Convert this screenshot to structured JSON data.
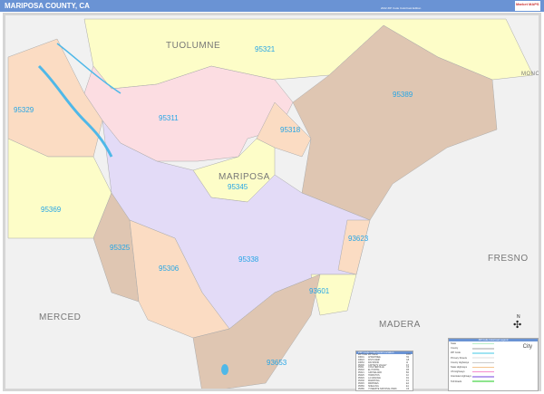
{
  "header": {
    "title": "MARIPOSA COUNTY, CA",
    "edition": "2022 ZIP Code ColorCast Edition",
    "logo": "Market MAPS"
  },
  "map": {
    "counties": [
      "TUOLUMNE",
      "MARIPOSA",
      "MERCED",
      "MADERA",
      "FRESNO",
      "MONO"
    ],
    "zips": [
      "95321",
      "95389",
      "95311",
      "95318",
      "95329",
      "95345",
      "95369",
      "93623",
      "95325",
      "95338",
      "95306",
      "93601",
      "93653"
    ],
    "colors": {
      "yellow": "#fdfdc8",
      "pink": "#fcdde2",
      "tan": "#dfc6b2",
      "lavender": "#e3dbf7",
      "peach": "#fbdcc3",
      "water": "#4fb8e8",
      "outside": "#f1f1f1"
    }
  },
  "zip_index": {
    "title": "ZIP Code Index/Grid Location",
    "headers": [
      "ZIP Code",
      "ZIP Name",
      "LOC"
    ],
    "rows": [
      [
        "93601",
        "AHWAHNEE",
        "H4"
      ],
      [
        "93623",
        "FISH CAMP",
        "G5"
      ],
      [
        "93653",
        "RAYMOND",
        "I4"
      ],
      [
        "95306",
        "CATHEYS VALLEY",
        "F3"
      ],
      [
        "95311",
        "COULTERVILLE",
        "C3"
      ],
      [
        "95318",
        "EL PORTAL",
        "D5"
      ],
      [
        "95321",
        "GROVELAND",
        "B4"
      ],
      [
        "95325",
        "HORNITOS",
        "F2"
      ],
      [
        "95329",
        "LA GRANGE",
        "D1"
      ],
      [
        "95338",
        "MARIPOSA",
        "F4"
      ],
      [
        "95345",
        "MIDPINES",
        "E4"
      ],
      [
        "95369",
        "SNELLING",
        "E1"
      ],
      [
        "95389",
        "YOSEMITE NATIONAL PARK",
        "C6"
      ]
    ]
  },
  "legend": {
    "title": "ZIP Code ColorCast Legend",
    "items": [
      {
        "label": "State",
        "color": "#b9efc7"
      },
      {
        "label": "County",
        "color": "#d0d0d0"
      },
      {
        "label": "ZIP Code",
        "color": "#9fe3f2"
      },
      {
        "label": "Primary Streets",
        "color": "#eeeeee"
      },
      {
        "label": "County Highways",
        "color": "#cccccc"
      },
      {
        "label": "State Highways",
        "color": "#f5c48e"
      },
      {
        "label": "US Highways",
        "color": "#f58ccc"
      },
      {
        "label": "Interstate Highways",
        "color": "#b9a0ee"
      },
      {
        "label": "Toll Roads",
        "color": "#8ee58e"
      }
    ],
    "city_label": "City"
  },
  "compass": "N"
}
